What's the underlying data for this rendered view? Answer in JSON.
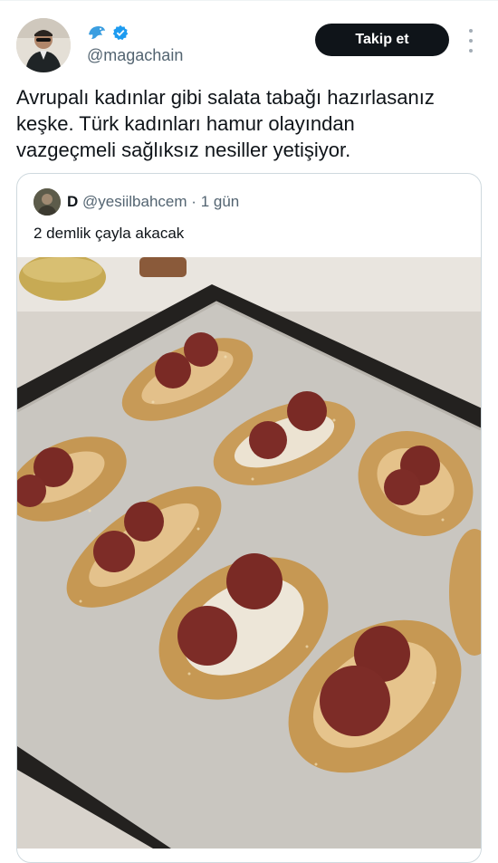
{
  "tweet": {
    "display_name_icon": "dolphin-emoji",
    "verified_icon": "verified-badge-icon",
    "handle": "@magachain",
    "follow_label": "Takip et",
    "more_icon": "more-vertical-icon",
    "text_lines": [
      "Avrupalı kadınlar gibi salata tabağı hazırlasanız",
      "keşke. Türk kadınları hamur olayından",
      "vazgeçmeli sağlıksız nesiller yetişiyor."
    ]
  },
  "quote": {
    "name": "D",
    "handle": "@yesiilbahcem",
    "separator": "·",
    "time": "1 gün",
    "text": "2 demlik çayla akacak",
    "image_subject": "pide-with-sucuk-on-baking-tray"
  },
  "colors": {
    "accent": "#1d9bf0",
    "text": "#0f1419",
    "muted": "#536471",
    "border": "#cfd9de",
    "button_bg": "#0f1419"
  }
}
